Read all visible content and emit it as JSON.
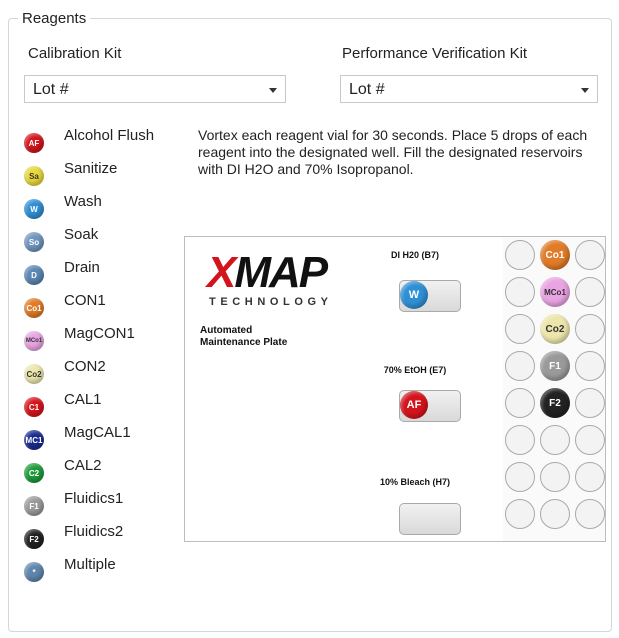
{
  "panel": {
    "title": "Reagents"
  },
  "calibration": {
    "label": "Calibration Kit",
    "value": "Lot #"
  },
  "verification": {
    "label": "Performance Verification Kit",
    "value": "Lot #"
  },
  "legend": [
    {
      "abbr": "AF",
      "label": "Alcohol Flush",
      "color": "#d4141c",
      "text_color": "#ffffff"
    },
    {
      "abbr": "Sa",
      "label": "Sanitize",
      "color": "#e8d83a",
      "text_color": "#333333"
    },
    {
      "abbr": "W",
      "label": "Wash",
      "color": "#2f8fd4",
      "text_color": "#ffffff"
    },
    {
      "abbr": "So",
      "label": "Soak",
      "color": "#6f95bd",
      "text_color": "#ffffff"
    },
    {
      "abbr": "D",
      "label": "Drain",
      "color": "#5a87b3",
      "text_color": "#ffffff"
    },
    {
      "abbr": "Co1",
      "label": "CON1",
      "color": "#e07b27",
      "text_color": "#ffffff"
    },
    {
      "abbr": "MCo1",
      "label": "MagCON1",
      "color": "#e9a4e2",
      "text_color": "#333333"
    },
    {
      "abbr": "Co2",
      "label": "CON2",
      "color": "#ece6ac",
      "text_color": "#333333"
    },
    {
      "abbr": "C1",
      "label": "CAL1",
      "color": "#d6141b",
      "text_color": "#ffffff"
    },
    {
      "abbr": "MC1",
      "label": "MagCAL1",
      "color": "#1b2b8f",
      "text_color": "#ffffff"
    },
    {
      "abbr": "C2",
      "label": "CAL2",
      "color": "#1d9a3a",
      "text_color": "#ffffff"
    },
    {
      "abbr": "F1",
      "label": "Fluidics1",
      "color": "#9a9a9a",
      "text_color": "#ffffff"
    },
    {
      "abbr": "F2",
      "label": "Fluidics2",
      "color": "#222222",
      "text_color": "#ffffff"
    },
    {
      "abbr": "*",
      "label": "Multiple",
      "color": "#5f86ad",
      "text_color": "#ffffff"
    }
  ],
  "instructions": "Vortex each reagent vial for 30 seconds. Place 5 drops of each reagent into the designated well. Fill the designated reservoirs with DI H2O and 70% Isopropanol.",
  "plate": {
    "logo_main": "XMAP",
    "logo_sub": "TECHNOLOGY",
    "title_line1": "Automated",
    "title_line2": "Maintenance Plate",
    "reservoirs": [
      {
        "label": "DI H20 (B7)",
        "badge": "W",
        "color": "#2f8fd4",
        "text_color": "#ffffff"
      },
      {
        "label": "70% EtOH (E7)",
        "badge": "AF",
        "color": "#d4141c",
        "text_color": "#ffffff"
      },
      {
        "label": "10% Bleach (H7)",
        "badge": "",
        "color": "",
        "text_color": ""
      }
    ],
    "wells": [
      [
        null,
        {
          "abbr": "Co1",
          "color": "#e07b27",
          "text_color": "#ffffff"
        },
        null
      ],
      [
        null,
        {
          "abbr": "MCo1",
          "color": "#e9a4e2",
          "text_color": "#333333"
        },
        null
      ],
      [
        null,
        {
          "abbr": "Co2",
          "color": "#ece6ac",
          "text_color": "#333333"
        },
        null
      ],
      [
        null,
        {
          "abbr": "F1",
          "color": "#9a9a9a",
          "text_color": "#ffffff"
        },
        null
      ],
      [
        null,
        {
          "abbr": "F2",
          "color": "#222222",
          "text_color": "#ffffff"
        },
        null
      ],
      [
        null,
        null,
        null
      ],
      [
        null,
        null,
        null
      ],
      [
        null,
        null,
        null
      ]
    ]
  }
}
